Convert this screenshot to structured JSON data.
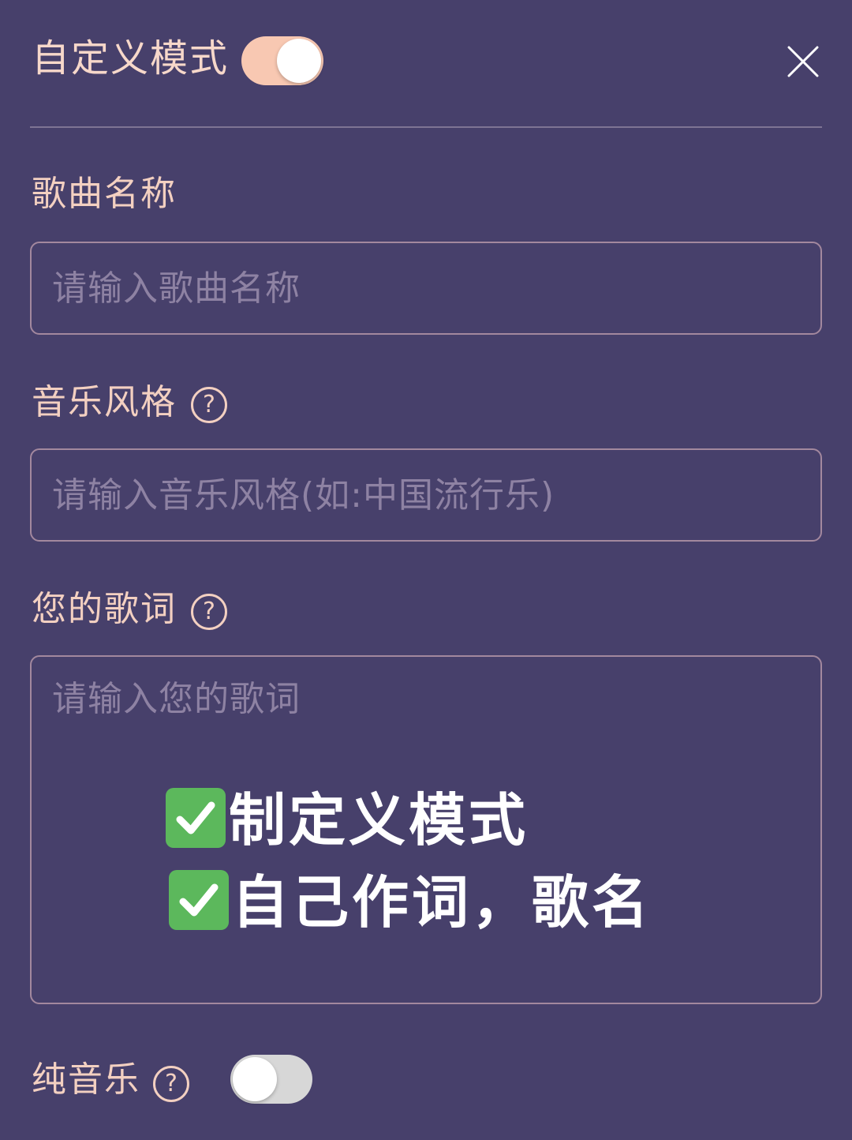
{
  "header": {
    "title": "自定义模式",
    "custom_mode_enabled": true
  },
  "song_name": {
    "label": "歌曲名称",
    "placeholder": "请输入歌曲名称",
    "value": ""
  },
  "music_style": {
    "label": "音乐风格",
    "placeholder": "请输入音乐风格(如:中国流行乐)",
    "value": ""
  },
  "lyrics": {
    "label": "您的歌词",
    "placeholder": "请输入您的歌词",
    "value": ""
  },
  "overlay": {
    "line1": "制定义模式",
    "line2": "自己作词，歌名"
  },
  "instrumental": {
    "label": "纯音乐",
    "enabled": false
  },
  "icons": {
    "close": "close-icon",
    "help": "help-circle-icon",
    "check": "check-box-icon"
  },
  "colors": {
    "background": "#47406b",
    "text": "#f3d0c1",
    "toggle_on": "#f8c8b2",
    "toggle_off": "#d7d7d7",
    "check": "#5cb85c"
  }
}
